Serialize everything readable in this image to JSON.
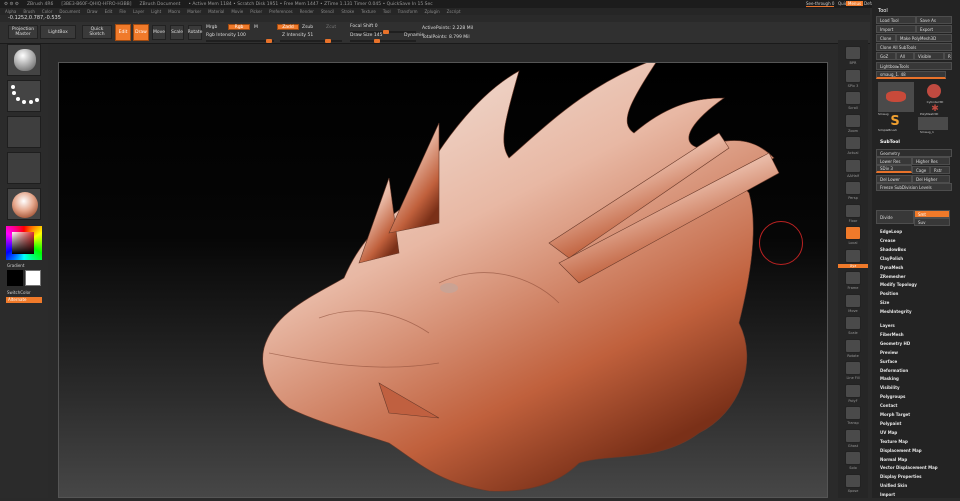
{
  "titlebar": {
    "app": "ZBrush 4R6",
    "mesh": "[3BE3-B60F-QHIQ-HFRO-H3BB]",
    "doc": "ZBrush Document",
    "stats": "• Active Mem 1184 • Scratch Disk 1951 • Free Mem 1447 • ZTime 1.131 Timer 0.045 • QuickSave In 15 Sec"
  },
  "menubar": [
    "Alpha",
    "Brush",
    "Color",
    "Document",
    "Draw",
    "Edit",
    "File",
    "Layer",
    "Light",
    "Macro",
    "Marker",
    "Material",
    "Movie",
    "Picker",
    "Preferences",
    "Render",
    "Stencil",
    "Stroke",
    "Texture",
    "Tool",
    "Transform",
    "Zplugin",
    "Zscript"
  ],
  "coords": "-0.1252,0.787,-0.535",
  "toolbar": {
    "projection_master": "Projection Master",
    "lightbox": "LightBox",
    "quick_sketch": "Quick Sketch",
    "edit": "Edit",
    "draw": "Draw",
    "move": "Move",
    "scale": "Scale",
    "rotate": "Rotate",
    "mrgb": "Mrgb",
    "rgb": "Rgb",
    "m": "M",
    "zadd": "Zadd",
    "zsub": "Zsub",
    "zcut": "Zcut",
    "rgb_intensity": "Rgb Intensity 100",
    "z_intensity": "Z Intensity 51",
    "focal_shift": "Focal Shift 0",
    "draw_size": "Draw Size 145",
    "dynamic": "Dynamic",
    "active_points": "ActivePoints: 2.228 Mil",
    "total_points": "TotalPoints: 8.799 Mil",
    "quicksave": "QuickSave",
    "see_through": "See-through 0",
    "menus": "Menus",
    "default_zscript": "DefaultZScript"
  },
  "leftpanel": {
    "gradient": "Gradient",
    "switch_color": "SwitchColor",
    "alternate": "Alternate"
  },
  "shelf": [
    "BPR",
    "SPix 3",
    "Scroll",
    "Zoom",
    "Actual",
    "AAHalf",
    "Persp",
    "Floor",
    "Local",
    "Xyz",
    "Frame",
    "Move",
    "Scale",
    "Rotate",
    "Line Fill",
    "PolyF",
    "Transp",
    "Ghost",
    "Solo",
    "Xpose"
  ],
  "rpanel": {
    "tool": "Tool",
    "load_tool": "Load Tool",
    "save_as": "Save As",
    "import": "Import",
    "export": "Export",
    "clone": "Clone",
    "make_polymesh": "Make PolyMesh3D",
    "clone_all": "Clone All SubTools",
    "goz": "GoZ",
    "all": "All",
    "visible": "Visible",
    "r": "R",
    "lightbox_tools": "Lightbox▸Tools",
    "tool_name": "smaug_1. 48",
    "tools": [
      "Smaug",
      "Cylinder3D",
      "PolyMesh3D",
      "SimpleBrush",
      "Smaug_1"
    ],
    "subtool": "SubTool",
    "geometry": "Geometry",
    "lower_res": "Lower Res",
    "higher_res": "Higher Res",
    "sdiv": "SDiv 3",
    "cage": "Cage",
    "rstr": "Rstr",
    "del_lower": "Del Lower",
    "del_higher": "Del Higher",
    "freeze": "Freeze SubDivision Levels",
    "divide": "Divide",
    "smt": "Smt",
    "suv": "Suv",
    "geom_items": [
      "EdgeLoop",
      "Crease",
      "ShadowBox",
      "ClayPolish",
      "DynaMesh",
      "ZRemesher",
      "Modify Topology",
      "Position",
      "Size",
      "MeshIntegrity"
    ],
    "sections": [
      "Layers",
      "FiberMesh",
      "Geometry HD",
      "Preview",
      "Surface",
      "Deformation",
      "Masking",
      "Visibility",
      "Polygroups",
      "Contact",
      "Morph Target",
      "Polypaint",
      "UV Map",
      "Texture Map",
      "Displacement Map",
      "Normal Map",
      "Vector Displacement Map",
      "Display Properties",
      "Unified Skin",
      "Import"
    ]
  },
  "colors": {
    "accent": "#f07a2a",
    "clay": "#d8785a"
  }
}
